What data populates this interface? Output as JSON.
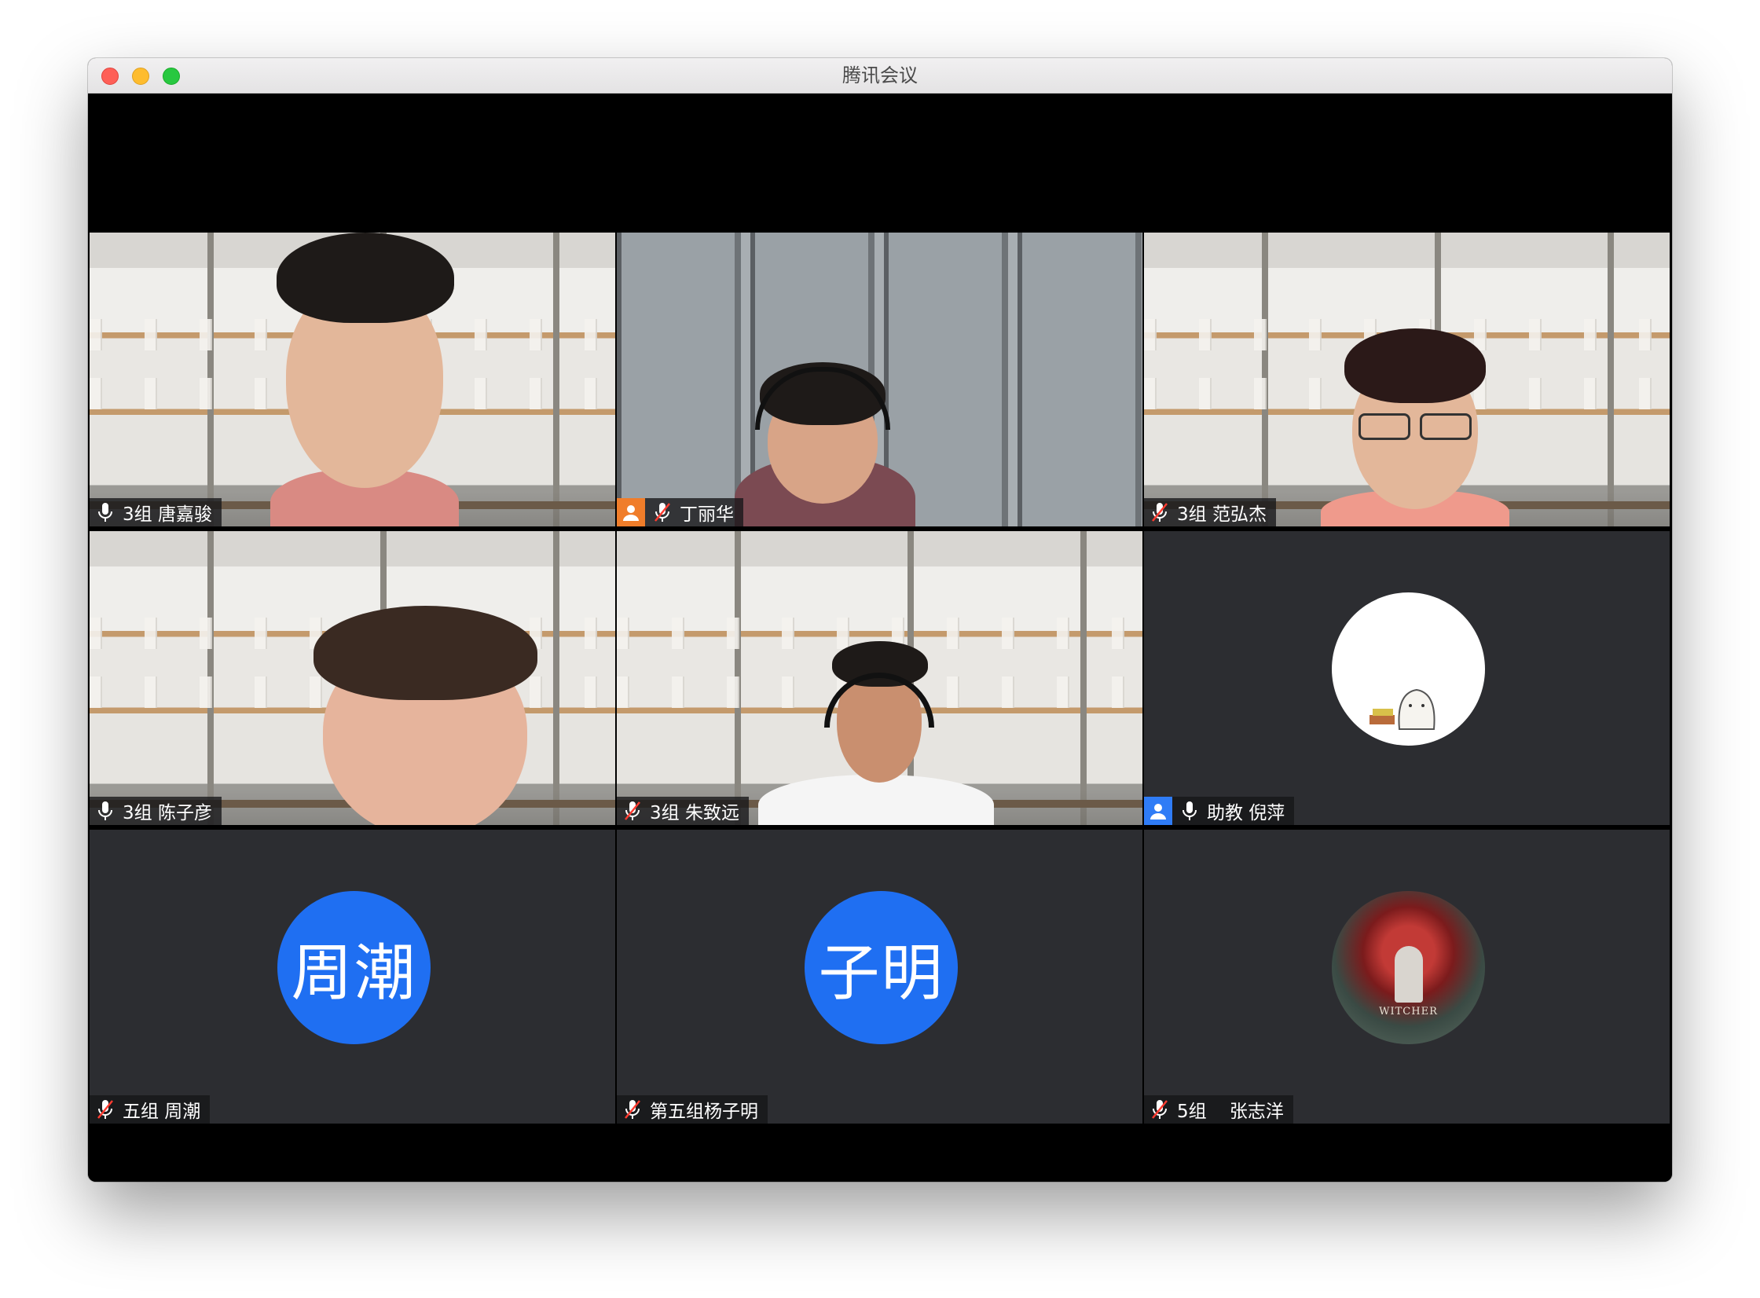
{
  "window": {
    "title": "腾讯会议"
  },
  "participants": [
    {
      "label": "3组 唐嘉骏",
      "mic": "on",
      "tile": "video"
    },
    {
      "label": "丁丽华",
      "mic": "muted",
      "tile": "video",
      "role_icon": "host"
    },
    {
      "label": "3组 范弘杰",
      "mic": "muted",
      "tile": "video"
    },
    {
      "label": "3组 陈子彦",
      "mic": "on",
      "tile": "video"
    },
    {
      "label": "3组 朱致远",
      "mic": "muted",
      "tile": "video"
    },
    {
      "label": "助教 倪萍",
      "mic": "on",
      "tile": "avatar",
      "role_icon": "assistant"
    },
    {
      "label": "五组 周潮",
      "mic": "muted",
      "tile": "avatar",
      "avatar_text": "周潮"
    },
    {
      "label": "第五组杨子明",
      "mic": "muted",
      "tile": "avatar",
      "avatar_text": "子明"
    },
    {
      "label": "5组    张志洋",
      "mic": "muted",
      "tile": "avatar",
      "avatar_image_text": "WITCHER"
    }
  ],
  "colors": {
    "avatar_blue": "#1f6ff2",
    "tile_bg": "#2c2d31",
    "host_badge": "#f07d2a",
    "assistant_badge": "#2f7cf6"
  }
}
